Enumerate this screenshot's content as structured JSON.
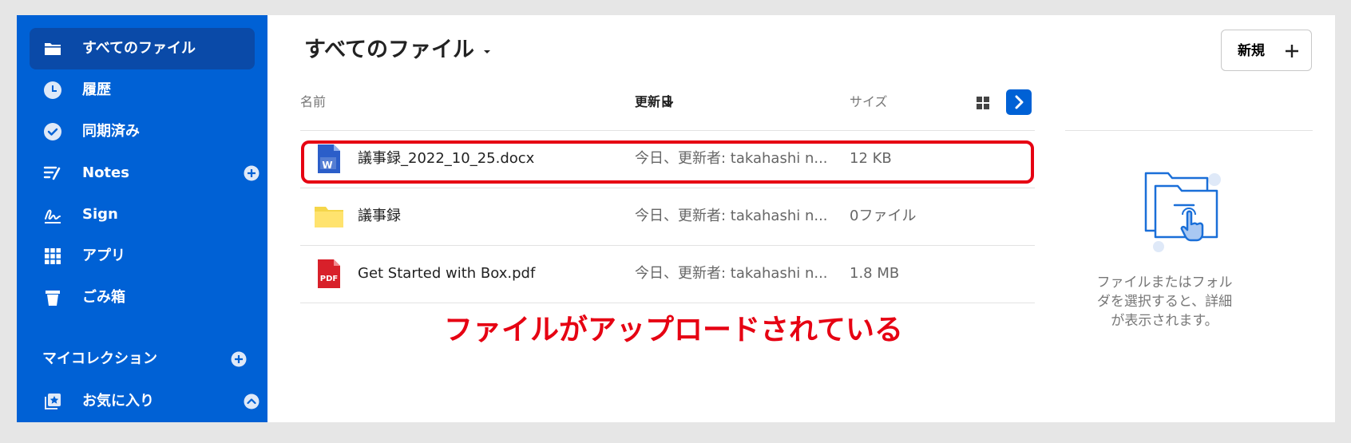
{
  "sidebar": {
    "items": [
      {
        "label": "すべてのファイル",
        "icon": "folder-icon",
        "active": true
      },
      {
        "label": "履歴",
        "icon": "clock-icon"
      },
      {
        "label": "同期済み",
        "icon": "check-circle-icon"
      },
      {
        "label": "Notes",
        "icon": "notes-icon",
        "add": true
      },
      {
        "label": "Sign",
        "icon": "signature-icon"
      },
      {
        "label": "アプリ",
        "icon": "apps-grid-icon"
      },
      {
        "label": "ごみ箱",
        "icon": "trash-icon"
      }
    ],
    "collections_title": "マイコレクション",
    "favorites_label": "お気に入り"
  },
  "main": {
    "title": "すべてのファイル",
    "new_button_label": "新規",
    "columns": {
      "name": "名前",
      "modified": "更新日",
      "size": "サイズ"
    },
    "rows": [
      {
        "name": "議事録_2022_10_25.docx",
        "modified": "今日、更新者: takahashi n...",
        "size": "12 KB",
        "type": "word-doc-icon"
      },
      {
        "name": "議事録",
        "modified": "今日、更新者: takahashi n...",
        "size": "0ファイル",
        "type": "folder-icon"
      },
      {
        "name": "Get Started with Box.pdf",
        "modified": "今日、更新者: takahashi n...",
        "size": "1.8 MB",
        "type": "pdf-icon"
      }
    ],
    "pdf_badge": "PDF",
    "word_badge": "W"
  },
  "annotation": {
    "caption": "ファイルがアップロードされている",
    "color": "#e60012"
  },
  "detail_panel": {
    "message": "ファイルまたはフォルダを選択すると、詳細が表示されます。"
  },
  "colors": {
    "brand": "#0061d5",
    "brand_dark": "#0a4aa8",
    "folder": "#ffe36e",
    "pdf": "#d8202a",
    "word": "#2b5ec9"
  }
}
